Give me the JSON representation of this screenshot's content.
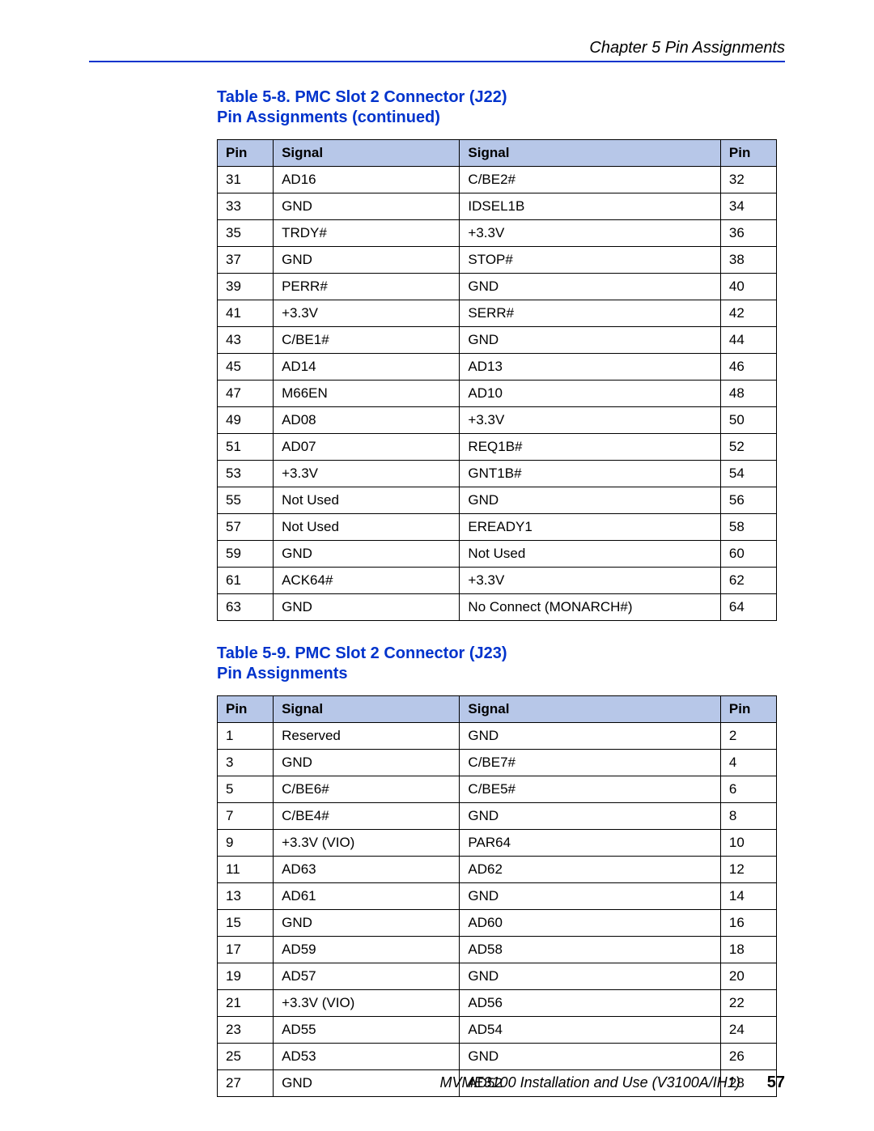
{
  "header": {
    "chapter": "Chapter 5  Pin Assignments"
  },
  "table1": {
    "title_line1": "Table 5-8. PMC Slot 2 Connector (J22)",
    "title_line2": "Pin Assignments (continued)",
    "headers": {
      "pin_left": "Pin",
      "signal_left": "Signal",
      "signal_right": "Signal",
      "pin_right": "Pin"
    },
    "rows": [
      {
        "pl": "31",
        "sl": "AD16",
        "sr": "C/BE2#",
        "pr": "32"
      },
      {
        "pl": "33",
        "sl": "GND",
        "sr": "IDSEL1B",
        "pr": "34"
      },
      {
        "pl": "35",
        "sl": "TRDY#",
        "sr": "+3.3V",
        "pr": "36"
      },
      {
        "pl": "37",
        "sl": "GND",
        "sr": "STOP#",
        "pr": "38"
      },
      {
        "pl": "39",
        "sl": "PERR#",
        "sr": "GND",
        "pr": "40"
      },
      {
        "pl": "41",
        "sl": "+3.3V",
        "sr": "SERR#",
        "pr": "42"
      },
      {
        "pl": "43",
        "sl": "C/BE1#",
        "sr": "GND",
        "pr": "44"
      },
      {
        "pl": "45",
        "sl": "AD14",
        "sr": "AD13",
        "pr": "46"
      },
      {
        "pl": "47",
        "sl": "M66EN",
        "sr": "AD10",
        "pr": "48"
      },
      {
        "pl": "49",
        "sl": "AD08",
        "sr": "+3.3V",
        "pr": "50"
      },
      {
        "pl": "51",
        "sl": "AD07",
        "sr": "REQ1B#",
        "pr": "52"
      },
      {
        "pl": "53",
        "sl": "+3.3V",
        "sr": "GNT1B#",
        "pr": "54"
      },
      {
        "pl": "55",
        "sl": "Not Used",
        "sr": "GND",
        "pr": "56"
      },
      {
        "pl": "57",
        "sl": "Not Used",
        "sr": "EREADY1",
        "pr": "58"
      },
      {
        "pl": "59",
        "sl": "GND",
        "sr": "Not Used",
        "pr": "60"
      },
      {
        "pl": "61",
        "sl": "ACK64#",
        "sr": "+3.3V",
        "pr": "62"
      },
      {
        "pl": "63",
        "sl": "GND",
        "sr": "No Connect (MONARCH#)",
        "pr": "64"
      }
    ]
  },
  "table2": {
    "title_line1": "Table 5-9. PMC Slot 2 Connector (J23)",
    "title_line2": "Pin Assignments",
    "headers": {
      "pin_left": "Pin",
      "signal_left": "Signal",
      "signal_right": "Signal",
      "pin_right": "Pin"
    },
    "rows": [
      {
        "pl": "1",
        "sl": "Reserved",
        "sr": "GND",
        "pr": "2"
      },
      {
        "pl": "3",
        "sl": "GND",
        "sr": "C/BE7#",
        "pr": "4"
      },
      {
        "pl": "5",
        "sl": "C/BE6#",
        "sr": "C/BE5#",
        "pr": "6"
      },
      {
        "pl": "7",
        "sl": "C/BE4#",
        "sr": "GND",
        "pr": "8"
      },
      {
        "pl": "9",
        "sl": "+3.3V (VIO)",
        "sr": "PAR64",
        "pr": "10"
      },
      {
        "pl": "11",
        "sl": "AD63",
        "sr": "AD62",
        "pr": "12"
      },
      {
        "pl": "13",
        "sl": "AD61",
        "sr": "GND",
        "pr": "14"
      },
      {
        "pl": "15",
        "sl": "GND",
        "sr": "AD60",
        "pr": "16"
      },
      {
        "pl": "17",
        "sl": "AD59",
        "sr": "AD58",
        "pr": "18"
      },
      {
        "pl": "19",
        "sl": "AD57",
        "sr": "GND",
        "pr": "20"
      },
      {
        "pl": "21",
        "sl": "+3.3V (VIO)",
        "sr": "AD56",
        "pr": "22"
      },
      {
        "pl": "23",
        "sl": "AD55",
        "sr": "AD54",
        "pr": "24"
      },
      {
        "pl": "25",
        "sl": "AD53",
        "sr": "GND",
        "pr": "26"
      },
      {
        "pl": "27",
        "sl": "GND",
        "sr": "AD52",
        "pr": "28"
      }
    ]
  },
  "footer": {
    "doc": "MVME3100 Installation and Use (V3100A/IH1)",
    "page": "57"
  }
}
